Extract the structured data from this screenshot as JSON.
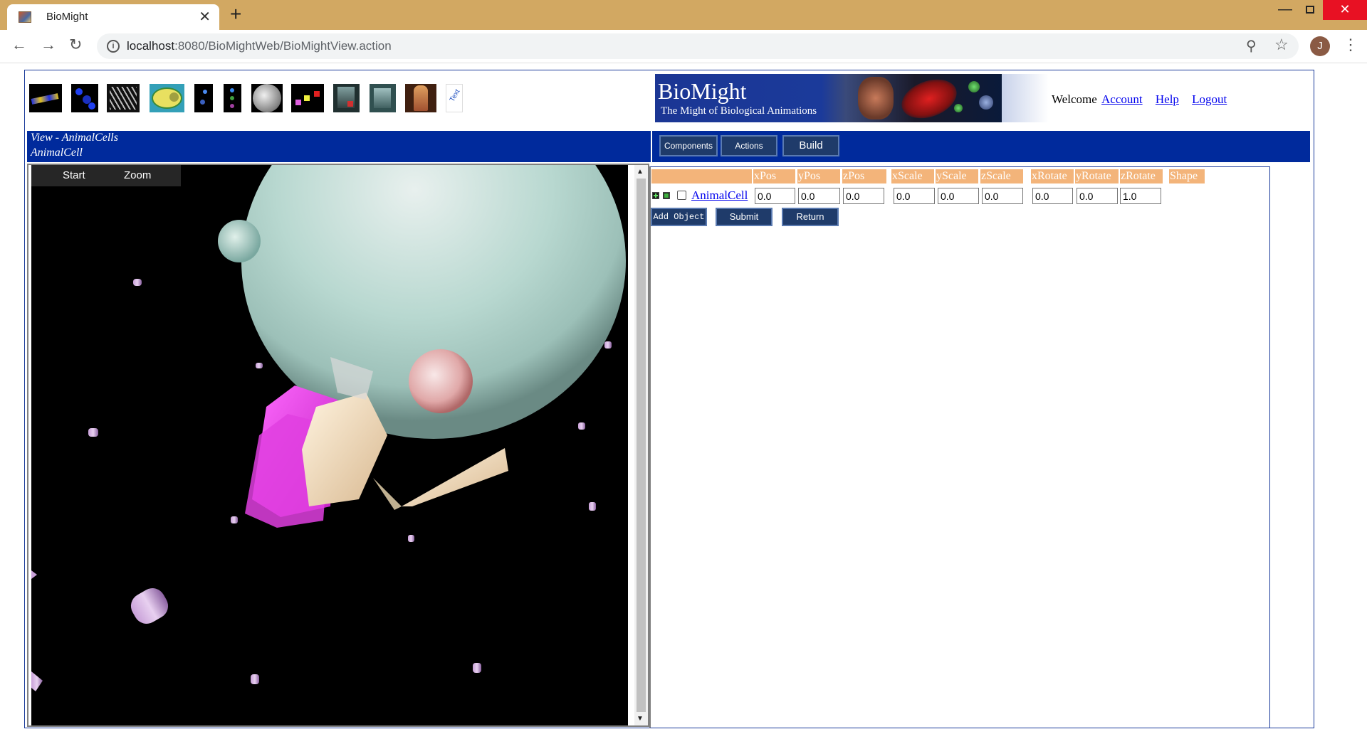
{
  "browser": {
    "tab_title": "BioMight",
    "tab_close": "✕",
    "new_tab": "+",
    "url_host": "localhost",
    "url_path": ":8080/BioMightWeb/BioMightView.action",
    "profile_initial": "J",
    "window_minimize": "—",
    "window_close": "✕"
  },
  "header": {
    "logo_title": "BioMight",
    "logo_subtitle": "The Might of Biological Animations",
    "welcome": "Welcome",
    "links": [
      "Account",
      "Help",
      "Logout"
    ],
    "toolbar_icons": [
      "molecule-chain-icon",
      "molecule-diagonal-icon",
      "dna-helix-icon",
      "animal-cell-icon",
      "molecules-small-icon",
      "organelles-icon",
      "sphere-cell-icon",
      "particles-icon",
      "tissue-icon",
      "organ-icon",
      "human-body-icon",
      "text-icon"
    ]
  },
  "view_header": {
    "line1": "View - AnimalCells",
    "line2": "AnimalCell"
  },
  "tabs": {
    "components": "Components",
    "actions": "Actions",
    "build": "Build"
  },
  "viewer": {
    "start": "Start",
    "zoom": "Zoom"
  },
  "table": {
    "columns": [
      "xPos",
      "yPos",
      "zPos",
      "xScale",
      "yScale",
      "zScale",
      "xRotate",
      "yRotate",
      "zRotate",
      "Shape"
    ],
    "row": {
      "name": "AnimalCell",
      "values": [
        "0.0",
        "0.0",
        "0.0",
        "0.0",
        "0.0",
        "0.0",
        "0.0",
        "0.0",
        "1.0"
      ]
    }
  },
  "buttons": {
    "add_object": "Add Object",
    "submit": "Submit",
    "return": "Return"
  },
  "colors": {
    "header_blue": "#002a9c",
    "column_header": "#f3b47a",
    "button_bg": "#1f3b6a",
    "chrome_tabbar": "#d2a862"
  }
}
